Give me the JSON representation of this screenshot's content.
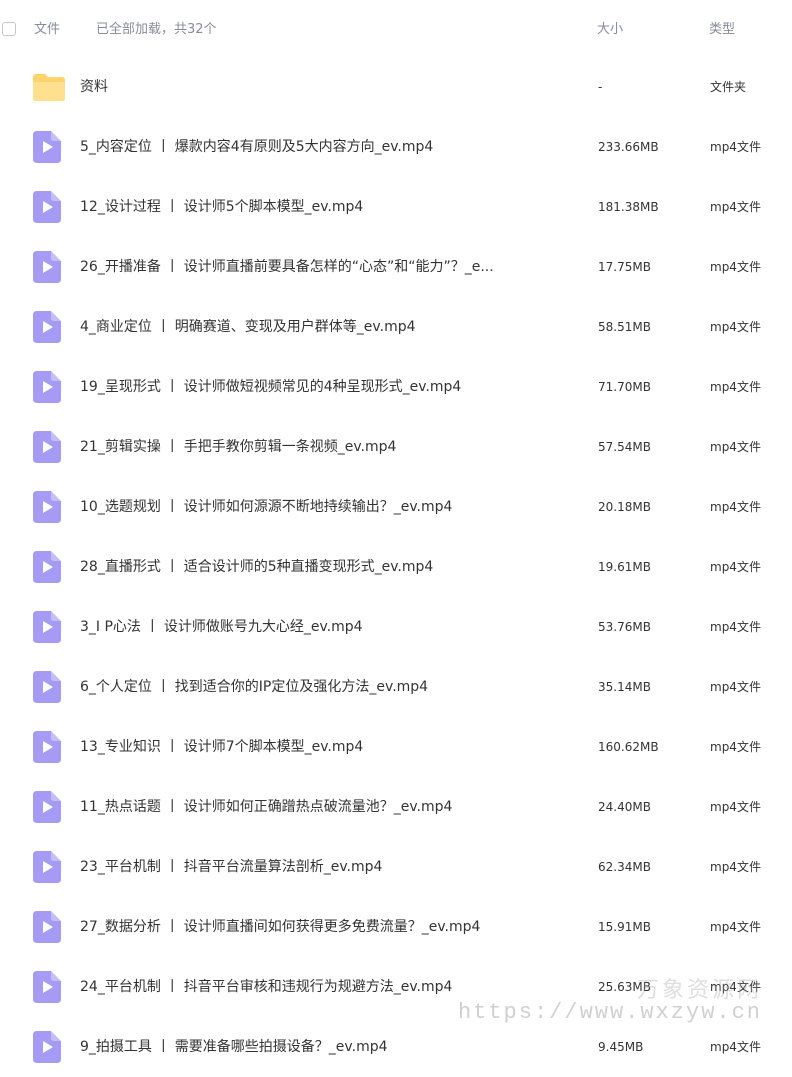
{
  "header": {
    "col_file": "文件",
    "status": "已全部加载，共32个",
    "col_size": "大小",
    "col_type": "类型"
  },
  "colors": {
    "video_icon": "#a59bf5",
    "folder_icon": "#ffd56b",
    "header_text": "#878c9c",
    "row_text": "#333333"
  },
  "rows": [
    {
      "icon": "folder-icon",
      "name": "资料",
      "size": "-",
      "type": "文件夹"
    },
    {
      "icon": "video-file-icon",
      "name": "5_内容定位 丨 爆款内容4有原则及5大内容方向_ev.mp4",
      "size": "233.66MB",
      "type": "mp4文件"
    },
    {
      "icon": "video-file-icon",
      "name": "12_设计过程 丨 设计师5个脚本模型_ev.mp4",
      "size": "181.38MB",
      "type": "mp4文件"
    },
    {
      "icon": "video-file-icon",
      "name": "26_开播准备 丨 设计师直播前要具备怎样的“心态”和“能力”？_e...",
      "size": "17.75MB",
      "type": "mp4文件"
    },
    {
      "icon": "video-file-icon",
      "name": "4_商业定位 丨 明确赛道、变现及用户群体等_ev.mp4",
      "size": "58.51MB",
      "type": "mp4文件"
    },
    {
      "icon": "video-file-icon",
      "name": "19_呈现形式 丨 设计师做短视频常见的4种呈现形式_ev.mp4",
      "size": "71.70MB",
      "type": "mp4文件"
    },
    {
      "icon": "video-file-icon",
      "name": "21_剪辑实操 丨 手把手教你剪辑一条视频_ev.mp4",
      "size": "57.54MB",
      "type": "mp4文件"
    },
    {
      "icon": "video-file-icon",
      "name": "10_选题规划 丨 设计师如何源源不断地持续输出？_ev.mp4",
      "size": "20.18MB",
      "type": "mp4文件"
    },
    {
      "icon": "video-file-icon",
      "name": "28_直播形式 丨 适合设计师的5种直播变现形式_ev.mp4",
      "size": "19.61MB",
      "type": "mp4文件"
    },
    {
      "icon": "video-file-icon",
      "name": "3_I P心法 丨 设计师做账号九大心经_ev.mp4",
      "size": "53.76MB",
      "type": "mp4文件"
    },
    {
      "icon": "video-file-icon",
      "name": "6_个人定位 丨 找到适合你的IP定位及强化方法_ev.mp4",
      "size": "35.14MB",
      "type": "mp4文件"
    },
    {
      "icon": "video-file-icon",
      "name": "13_专业知识 丨 设计师7个脚本模型_ev.mp4",
      "size": "160.62MB",
      "type": "mp4文件"
    },
    {
      "icon": "video-file-icon",
      "name": "11_热点话题 丨 设计师如何正确蹭热点破流量池？_ev.mp4",
      "size": "24.40MB",
      "type": "mp4文件"
    },
    {
      "icon": "video-file-icon",
      "name": "23_平台机制 丨 抖音平台流量算法剖析_ev.mp4",
      "size": "62.34MB",
      "type": "mp4文件"
    },
    {
      "icon": "video-file-icon",
      "name": "27_数据分析 丨 设计师直播间如何获得更多免费流量？_ev.mp4",
      "size": "15.91MB",
      "type": "mp4文件"
    },
    {
      "icon": "video-file-icon",
      "name": "24_平台机制 丨 抖音平台审核和违规行为规避方法_ev.mp4",
      "size": "25.63MB",
      "type": "mp4文件"
    },
    {
      "icon": "video-file-icon",
      "name": "9_拍摄工具 丨 需要准备哪些拍摄设备？_ev.mp4",
      "size": "9.45MB",
      "type": "mp4文件"
    }
  ],
  "watermark": {
    "brand": "万象资源网",
    "url": "https://www.wxzyw.cn"
  }
}
